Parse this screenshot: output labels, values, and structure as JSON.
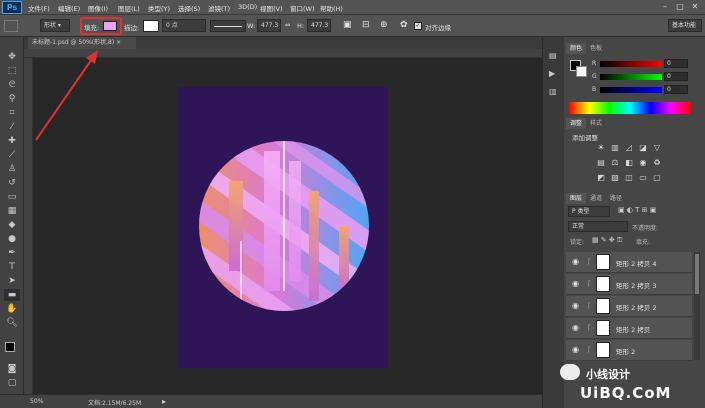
{
  "app": {
    "logo": "Ps"
  },
  "menubar": {
    "items": [
      "文件(F)",
      "编辑(E)",
      "图像(I)",
      "图层(L)",
      "类型(Y)",
      "选择(S)",
      "滤镜(T)",
      "3D(D)",
      "视图(V)",
      "窗口(W)",
      "帮助(H)"
    ],
    "window_controls": [
      "–",
      "□",
      "✕"
    ]
  },
  "options_bar": {
    "shape_mode": "形状",
    "fill_label": "填充:",
    "fill_color": "#e7a4f0",
    "stroke_label": "描边:",
    "stroke_width": "0 点",
    "width_label": "W:",
    "width_value": "477.3",
    "height_label": "H:",
    "height_value": "477.3",
    "align_edges_label": "对齐边缘",
    "workspace": "基本功能"
  },
  "document": {
    "tab_title": "未标题-1.psd @ 50%(形状,8)",
    "tab_close": "×",
    "zoom": "50%",
    "doc_info": "文档:2.15M/6.25M",
    "background_color": "#2d1558"
  },
  "panels": {
    "color_tabs": [
      "颜色",
      "色板"
    ],
    "color_labels": {
      "r": "R",
      "g": "G",
      "b": "B"
    },
    "color_values": {
      "r": "0",
      "g": "0",
      "b": "0"
    },
    "adjust_tabs": [
      "调整",
      "样式"
    ],
    "adjust_title": "添加调整",
    "layer_tabs": [
      "图层",
      "通道",
      "路径"
    ],
    "layer_filter": "P 类型",
    "blend_mode": "正常",
    "opacity_label": "不透明度:",
    "lock_label": "锁定:",
    "fill_label": "填充:",
    "layers": [
      "矩形 2 拷贝 4",
      "矩形 2 拷贝 3",
      "矩形 2 拷贝 2",
      "矩形 2 拷贝",
      "矩形 2"
    ]
  },
  "watermark": {
    "text": "小线设计",
    "site": "UiBQ.CoM"
  }
}
